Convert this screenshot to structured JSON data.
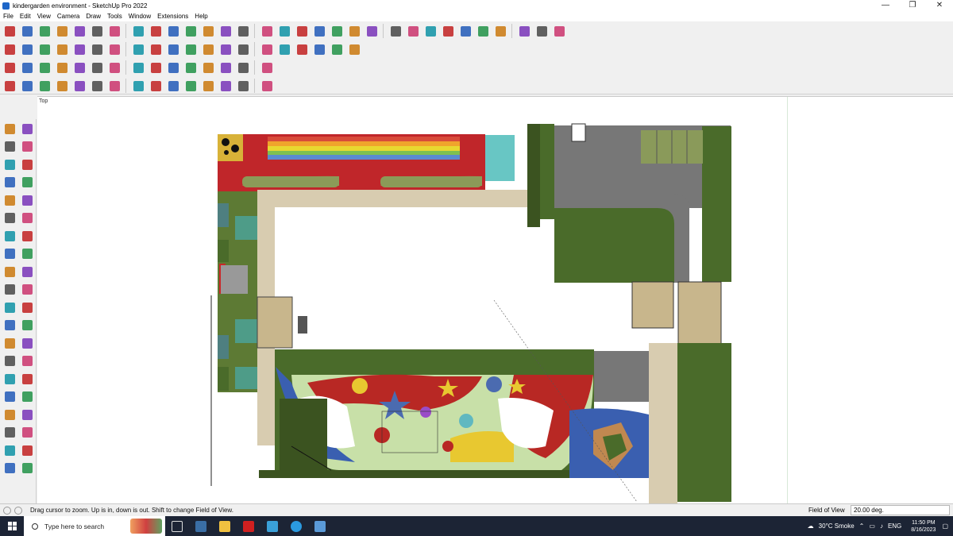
{
  "window": {
    "title": "kindergarden environment - SketchUp Pro 2022",
    "controls": [
      "—",
      "❐",
      "✕"
    ]
  },
  "menu": [
    "File",
    "Edit",
    "View",
    "Camera",
    "Draw",
    "Tools",
    "Window",
    "Extensions",
    "Help"
  ],
  "viewport": {
    "scene_label": "Top"
  },
  "status": {
    "hint": "Drag cursor to zoom.  Up is in, down is out. Shift to change Field of View.",
    "measure_label": "Field of View",
    "measure_value": "20.00 deg."
  },
  "taskbar": {
    "search_placeholder": "Type here to search",
    "weather": "30°C  Smoke",
    "language": "ENG",
    "time": "11:50 PM",
    "date": "8/16/2023"
  },
  "icons": {
    "toolbar_row1": [
      "search-icon",
      "select-arrow-icon",
      "eraser-icon",
      "pencil-line-icon",
      "arc-icon",
      "rectangle-icon",
      "push-pull-icon",
      "follow-me-icon",
      "move-icon",
      "scale-icon",
      "offset-icon",
      "tape-measure-icon",
      "text-icon",
      "paint-bucket-icon",
      "orbit-icon",
      "pan-icon",
      "zoom-icon",
      "zoom-extents-icon",
      "iso-view-icon",
      "top-view-icon",
      "front-view-icon",
      "geo-location-icon",
      "components-icon",
      "section-plane-icon",
      "x-ray-icon",
      "back-edges-icon",
      "hidden-line-icon",
      "shaded-icon",
      "undo-icon",
      "redo-icon",
      "info-icon"
    ],
    "toolbar_row2": [
      "box-icon",
      "cube-icon",
      "stack-icon",
      "arrow-down-red-icon",
      "arrow-down-blue-icon",
      "arrow-down-green-icon",
      "arrow-down-magenta-icon",
      "arrow-down-orange-icon",
      "curve-icon",
      "face-icon",
      "folder-icon",
      "house-icon",
      "circle-icon",
      "ellipse-icon",
      "polygon-icon",
      "ruler-icon",
      "paint-icon",
      "tag-icon",
      "solid-icon",
      "material-icon"
    ],
    "toolbar_row3": [
      "cube-blue-icon",
      "plane-icon",
      "red-hex-icon",
      "curve-orange-icon",
      "box-red-icon",
      "box-outline-icon",
      "move-red-icon",
      "cross-green-icon",
      "cross-blue-icon",
      "cone-icon",
      "pyramid-icon",
      "torus-icon",
      "sphere-icon",
      "grid-icon",
      "dots-icon"
    ],
    "toolbar_row4": [
      "line-tool-icon",
      "polyline-icon",
      "shape-icon",
      "sweep-icon",
      "loft-icon",
      "extrude-icon",
      "bend-icon",
      "twist-icon",
      "shell-icon",
      "fillet-icon",
      "chamfer-icon",
      "wire-icon",
      "mesh-icon",
      "quad-icon",
      "subdivide-icon"
    ],
    "left_tools": [
      "select-icon",
      "orbit-icon",
      "paint-bucket-icon",
      "eraser-icon",
      "component-icon",
      "tag-icon",
      "line-icon",
      "freehand-icon",
      "rectangle-icon",
      "rotated-rect-icon",
      "circle-icon",
      "polygon-icon",
      "arc-icon",
      "pie-icon",
      "arc3-icon",
      "arc2-icon",
      "move-icon",
      "push-pull-icon",
      "rotate-icon",
      "follow-me-icon",
      "scale-icon",
      "offset-icon",
      "tape-measure-icon",
      "dimension-icon",
      "protractor-icon",
      "text-icon",
      "axes-icon",
      "3d-text-icon",
      "orbit2-icon",
      "pan-icon",
      "zoom-icon",
      "zoom-window-icon",
      "zoom-extents-icon",
      "previous-icon",
      "position-camera-icon",
      "look-around-icon",
      "walk-icon",
      "section-icon",
      "sandbox-icon",
      "stamp-icon"
    ]
  },
  "colors": {
    "accent_red": "#c0262a",
    "grass": "#4a6b2a",
    "paving": "#d8ccb0",
    "asphalt": "#777",
    "play_red": "#b82824",
    "play_green": "#c8e0a8",
    "play_blue": "#3a5fb0",
    "play_yellow": "#e8c830"
  }
}
